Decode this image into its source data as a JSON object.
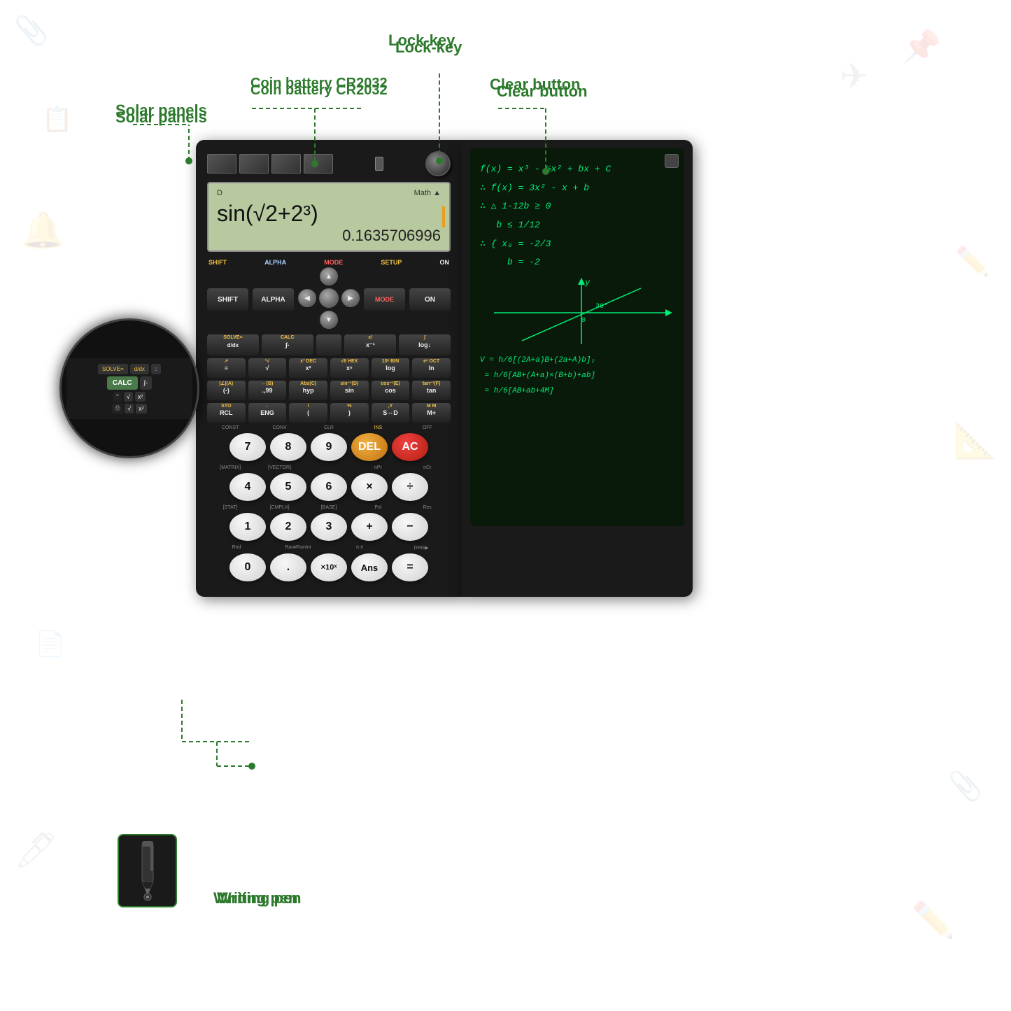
{
  "labels": {
    "solar_panels": "Solar panels",
    "coin_battery": "Coin battery CR2032",
    "lock_key": "Lock-key",
    "clear_button": "Clear button",
    "writing_pen": "Writing pen"
  },
  "display": {
    "top_left": "D",
    "top_right": "Math ▲",
    "main_expr": "sin(√2+2³)",
    "result": "0.1635706996"
  },
  "notepad_math": [
    "f(x) = x³ - ½x² + bx + C",
    "∴ f(x) = 3x² - x + b",
    "∴ △ 1-12b ≥ 0",
    "b ≤ 1/12",
    "∴ { x₀ = -2/3",
    "  b = -2"
  ],
  "notepad_math2": [
    "V = h/6[(2A+a)B+(2a+A)b]₂",
    "  = h/6[AB+(A+a)×(B+b)+ab]",
    "  = h/6[AB+ab+4M]"
  ],
  "buttons": {
    "top_labels": [
      "SHIFT",
      "ALPHA",
      "MODE",
      "SETUP",
      "ON"
    ],
    "row1": [
      "SOLVE=",
      "d/dx",
      "÷",
      "x!",
      "∫"
    ],
    "row1_labels": [
      "CALC",
      "∫-",
      "",
      "x⁻¹",
      "log↓"
    ],
    "row2": [
      "↗",
      "³√",
      "x³",
      "DEC",
      "√6",
      "HEX",
      "10ˣ",
      "BIN"
    ],
    "row2_calc": [
      "≡",
      "√",
      "x²",
      "xⁿ",
      "log",
      "ln"
    ],
    "row3": [
      "|∠|A",
      "←(B)",
      "Abs(C)",
      "sin⁻¹(D)",
      "cos⁻¹(E)",
      "tan⁻¹(F)"
    ],
    "row3_calc": [
      "(-)",
      ".,99",
      "hyp",
      "sin",
      "cos",
      "tan"
    ],
    "row4": [
      "STO",
      "←",
      "i",
      "%",
      ".",
      ",Y"
    ],
    "row4_calc": [
      "RCL",
      "ENG",
      "(",
      ")",
      "S⇔D",
      "M+"
    ],
    "num_labels_row1": [
      "CONST",
      "CONV",
      "CLR",
      "INS",
      "OFF"
    ],
    "num_row1": [
      "7",
      "8",
      "9",
      "DEL",
      "AC"
    ],
    "num_labels_row2": [
      "[MATRIX]",
      "[VECTOR]",
      "",
      "nPr",
      "nCr"
    ],
    "num_row2": [
      "4",
      "5",
      "6",
      "×",
      "÷"
    ],
    "num_labels_row3": [
      "[STAT]",
      "[CMPLX]",
      "[BASE]",
      "Pol",
      "Rec"
    ],
    "num_row3": [
      "1",
      "2",
      "3",
      "+",
      "-"
    ],
    "num_labels_row4": [
      "Rnd",
      "Ran#",
      "RanInt",
      "π",
      "e",
      "DRG▶"
    ],
    "num_row4": [
      "0",
      ".",
      "×10ˣ",
      "Ans",
      "="
    ]
  },
  "zoom_label": "CALC",
  "colors": {
    "green_label": "#2d7a2d",
    "bg_white": "#ffffff",
    "calc_body": "#1a1a1a",
    "display_bg": "#b8c9a0",
    "del_orange": "#e8a020",
    "ac_red": "#e84020"
  }
}
